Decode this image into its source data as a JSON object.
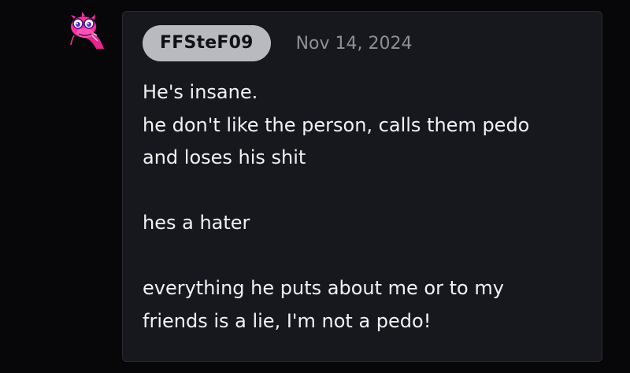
{
  "comment": {
    "avatar_icon": "pink-cartoon-avatar-icon",
    "username": "FFSteF09",
    "date": "Nov 14, 2024",
    "lines": [
      "He's insane.",
      "he don't like the person, calls them pedo",
      "and loses his shit",
      "",
      "hes a hater",
      "",
      "everything he puts about me or to my",
      "friends is a lie, I'm not a pedo!"
    ]
  },
  "colors": {
    "background": "#070709",
    "card": "#17181d",
    "username_pill": "#b9bac0",
    "date_text": "#8f9096",
    "body_text": "#f2f2f4",
    "avatar_pink": "#ff2fa0"
  }
}
